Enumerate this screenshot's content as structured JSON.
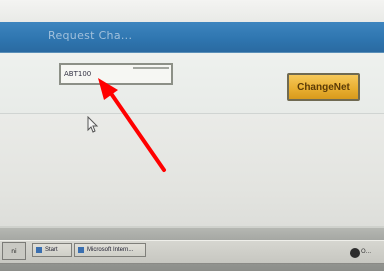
{
  "dialog": {
    "title": "Request Cha..."
  },
  "search": {
    "value": "ABT100"
  },
  "button": {
    "label": "ChangeNet"
  },
  "taskbar": {
    "start_label": "ni",
    "items": [
      {
        "label": "Start"
      },
      {
        "label": "Microsoft Intern..."
      }
    ],
    "tray_label": "O..."
  },
  "colors": {
    "header_blue": "#2f76b0",
    "button_orange": "#e9b032",
    "arrow_red": "#ff0000"
  },
  "icons": [
    "mouse-pointer-icon",
    "red-arrow-annotation",
    "windows-tray-icon"
  ]
}
